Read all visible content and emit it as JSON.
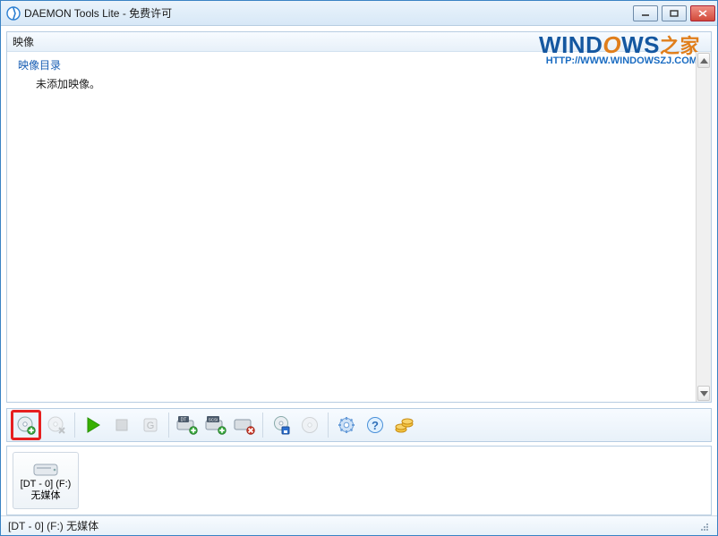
{
  "window": {
    "title": "DAEMON Tools Lite - 免费许可"
  },
  "panels": {
    "images": {
      "header": "映像",
      "root_label": "映像目录",
      "empty_label": "未添加映像。"
    }
  },
  "watermark": {
    "line1_a": "WIND",
    "line1_b": "O",
    "line1_c": "WS",
    "line1_d": "之家",
    "line2": "HTTP://WWW.WINDOWSZJ.COM/"
  },
  "toolbar": {
    "add_image": "add-image",
    "remove_image": "remove-image",
    "mount": "mount",
    "stop": "stop",
    "refresh": "refresh",
    "add_dt_drive": "add-dt-virtual-drive",
    "add_scsi_drive": "add-scsi-virtual-drive",
    "remove_drive": "remove-virtual-drive",
    "burn": "burn-image",
    "disc": "create-disc-image",
    "preferences": "preferences",
    "help": "help",
    "buy": "buy-license"
  },
  "device": {
    "line1": "[DT - 0] (F:)",
    "line2": "无媒体"
  },
  "statusbar": {
    "text": "[DT - 0] (F:) 无媒体"
  },
  "colors": {
    "highlight": "#e62020",
    "link": "#1a5fb4",
    "accent_blue": "#1457a0",
    "accent_orange": "#e07e1b"
  }
}
